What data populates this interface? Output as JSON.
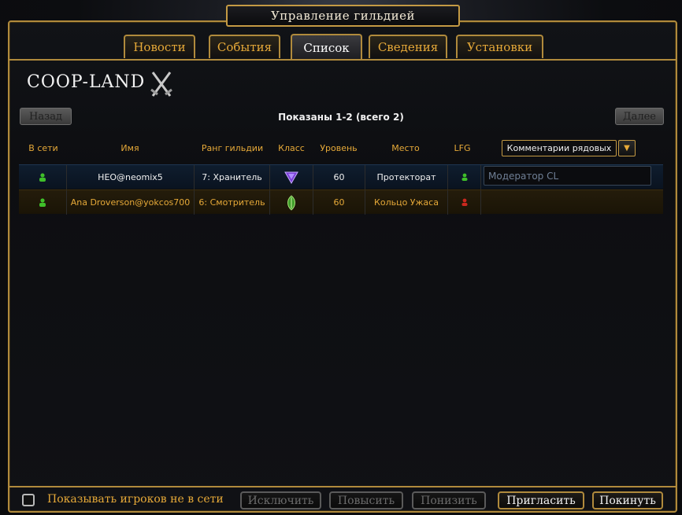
{
  "window": {
    "title": "Управление гильдией"
  },
  "tabs": [
    {
      "label": "Новости",
      "active": false
    },
    {
      "label": "События",
      "active": false
    },
    {
      "label": "Список",
      "active": true
    },
    {
      "label": "Сведения",
      "active": false
    },
    {
      "label": "Установки",
      "active": false
    }
  ],
  "guild": {
    "name": "COOP-LAND",
    "emblem_icon": "crossed-swords-icon"
  },
  "pagination": {
    "prev_label": "Назад",
    "next_label": "Далее",
    "info": "Показаны 1-2 (всего 2)"
  },
  "columns": {
    "online": "В сети",
    "name": "Имя",
    "rank": "Ранг гильдии",
    "class": "Класс",
    "level": "Уровень",
    "location": "Место",
    "lfg": "LFG",
    "comment_select": "Комментарии рядовых"
  },
  "members": [
    {
      "online_icon": "online-person-icon",
      "name": "HEO@neomix5",
      "rank": "7: Хранитель",
      "class_icon": "purple-triangle-class-icon",
      "level": "60",
      "location": "Протекторат",
      "lfg_icon": "lfg-green-icon",
      "comment": "Модератор CL"
    },
    {
      "online_icon": "online-person-icon",
      "name": "Ana Droverson@yokcos700",
      "rank": "6: Смотритель",
      "class_icon": "green-leaf-class-icon",
      "level": "60",
      "location": "Кольцо Ужаса",
      "lfg_icon": "lfg-red-icon",
      "comment": ""
    }
  ],
  "footer": {
    "show_offline_label": "Показывать игроков не в сети",
    "show_offline_checked": false,
    "kick_label": "Исключить",
    "promote_label": "Повысить",
    "demote_label": "Понизить",
    "invite_label": "Пригласить",
    "leave_label": "Покинуть"
  },
  "colors": {
    "accent_gold": "#e6a938",
    "border_gold": "#b08a3c",
    "online_green": "#3fbf2a",
    "lfg_red": "#c9281e"
  }
}
